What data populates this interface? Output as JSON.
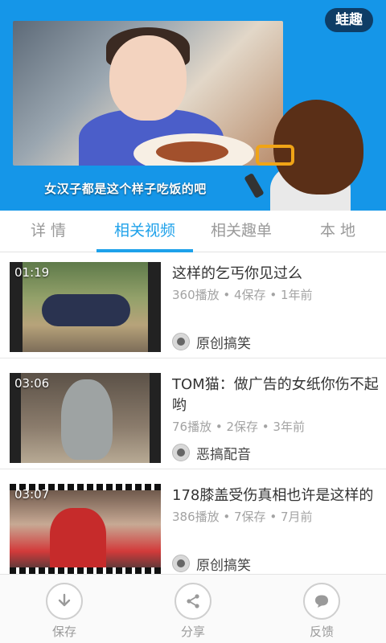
{
  "hero": {
    "brand": "蛙趣",
    "caption": "女汉子都是这个样子吃饭的吧"
  },
  "tabs": [
    {
      "label": "详 情",
      "active": false
    },
    {
      "label": "相关视频",
      "active": true
    },
    {
      "label": "相关趣单",
      "active": false
    },
    {
      "label": "本 地",
      "active": false
    }
  ],
  "videos": [
    {
      "duration": "01:19",
      "title": "这样的乞丐你见过么",
      "meta": "360播放 • 4保存 • 1年前",
      "author": "原创搞笑"
    },
    {
      "duration": "03:06",
      "title": "TOM猫：做广告的女纸你伤不起哟",
      "meta": "76播放 • 2保存 • 3年前",
      "author": "恶搞配音"
    },
    {
      "duration": "03:07",
      "title": "178膝盖受伤真相也许是这样的",
      "meta": "386播放 • 7保存 • 7月前",
      "author": "原创搞笑"
    }
  ],
  "actions": [
    {
      "label": "保存",
      "icon": "download-icon"
    },
    {
      "label": "分享",
      "icon": "share-icon"
    },
    {
      "label": "反馈",
      "icon": "chat-bubble-icon"
    }
  ],
  "colors": {
    "accent": "#1ea1ea",
    "hero_bg": "#1596e8"
  }
}
